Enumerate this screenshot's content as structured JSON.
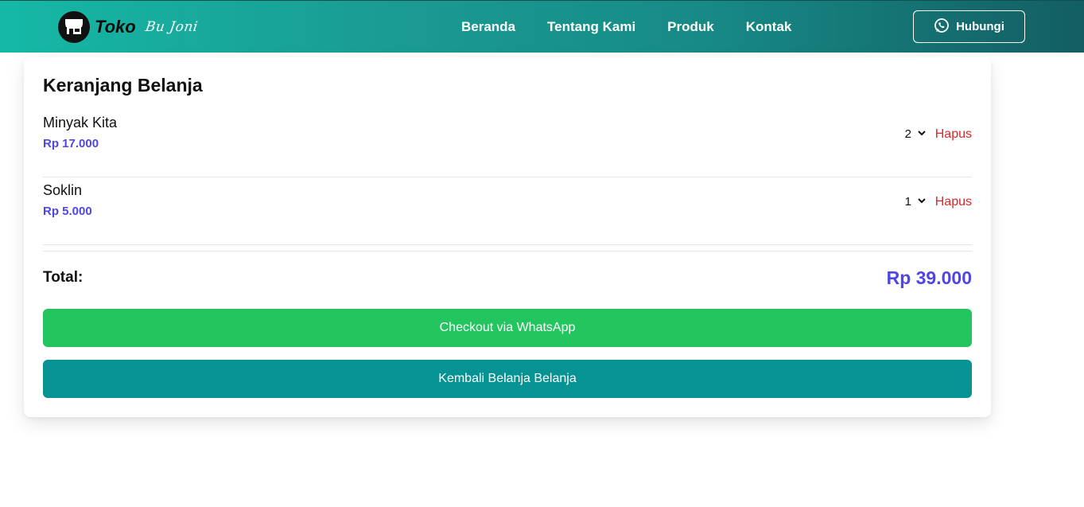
{
  "brand": {
    "name": "Toko",
    "script": "Bu Joni",
    "logo_icon": "store-icon"
  },
  "nav": {
    "items": [
      {
        "label": "Beranda"
      },
      {
        "label": "Tentang Kami"
      },
      {
        "label": "Produk"
      },
      {
        "label": "Kontak"
      }
    ]
  },
  "header_button": {
    "label": "Hubungi",
    "icon": "whatsapp-icon"
  },
  "cart": {
    "title": "Keranjang Belanja",
    "items": [
      {
        "name": "Minyak Kita",
        "price": "Rp 17.000",
        "qty": "2",
        "remove_label": "Hapus"
      },
      {
        "name": "Soklin",
        "price": "Rp 5.000",
        "qty": "1",
        "remove_label": "Hapus"
      }
    ],
    "total_label": "Total:",
    "total_value": "Rp 39.000",
    "checkout_label": "Checkout via WhatsApp",
    "back_label": "Kembali Belanja Belanja"
  },
  "colors": {
    "nav_start": "#15b8a6",
    "nav_end": "#135e63",
    "price": "#4f46e5",
    "remove": "#dc2626",
    "checkout": "#22c55e",
    "back": "#079293"
  }
}
